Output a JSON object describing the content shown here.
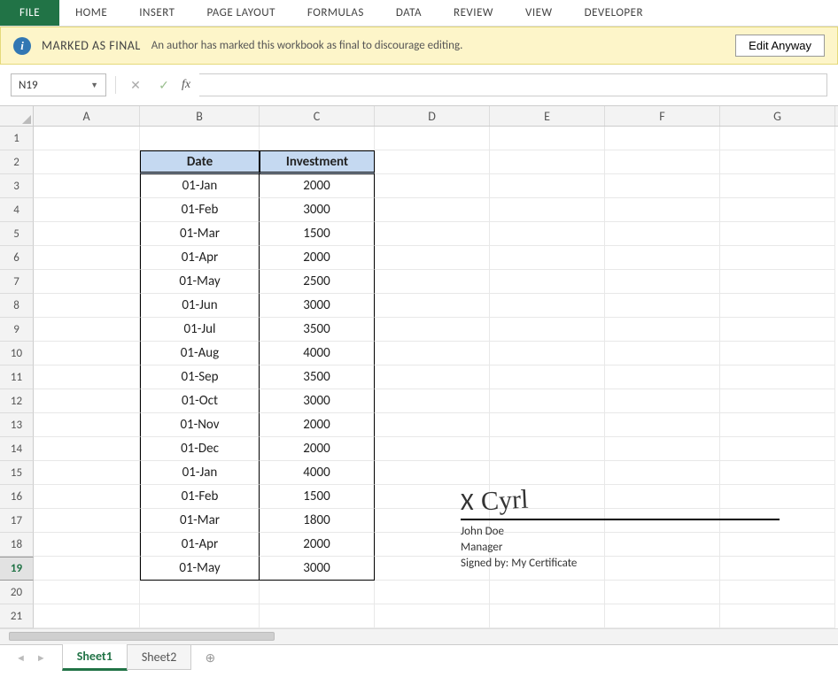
{
  "ribbon": {
    "file": "FILE",
    "tabs": [
      "HOME",
      "INSERT",
      "PAGE LAYOUT",
      "FORMULAS",
      "DATA",
      "REVIEW",
      "VIEW",
      "DEVELOPER"
    ]
  },
  "infobar": {
    "icon_letter": "i",
    "title": "MARKED AS FINAL",
    "body": "An author has marked this workbook as final to discourage editing.",
    "button": "Edit Anyway"
  },
  "formula_bar": {
    "namebox": "N19",
    "fx_label": "fx",
    "formula": ""
  },
  "columns": [
    "A",
    "B",
    "C",
    "D",
    "E",
    "F",
    "G"
  ],
  "active_row": 19,
  "table": {
    "headers": {
      "B": "Date",
      "C": "Investment"
    },
    "rows": [
      {
        "date": "01-Jan",
        "investment": "2000"
      },
      {
        "date": "01-Feb",
        "investment": "3000"
      },
      {
        "date": "01-Mar",
        "investment": "1500"
      },
      {
        "date": "01-Apr",
        "investment": "2000"
      },
      {
        "date": "01-May",
        "investment": "2500"
      },
      {
        "date": "01-Jun",
        "investment": "3000"
      },
      {
        "date": "01-Jul",
        "investment": "3500"
      },
      {
        "date": "01-Aug",
        "investment": "4000"
      },
      {
        "date": "01-Sep",
        "investment": "3500"
      },
      {
        "date": "01-Oct",
        "investment": "3000"
      },
      {
        "date": "01-Nov",
        "investment": "2000"
      },
      {
        "date": "01-Dec",
        "investment": "2000"
      },
      {
        "date": "01-Jan",
        "investment": "4000"
      },
      {
        "date": "01-Feb",
        "investment": "1500"
      },
      {
        "date": "01-Mar",
        "investment": "1800"
      },
      {
        "date": "01-Apr",
        "investment": "2000"
      },
      {
        "date": "01-May",
        "investment": "3000"
      }
    ]
  },
  "total_rows": 21,
  "signature": {
    "x": "X",
    "mark": "Cyrl",
    "name": "John Doe",
    "title": "Manager",
    "signed_by": "Signed by: My Certificate"
  },
  "sheets": {
    "tabs": [
      "Sheet1",
      "Sheet2"
    ],
    "active": 0
  }
}
